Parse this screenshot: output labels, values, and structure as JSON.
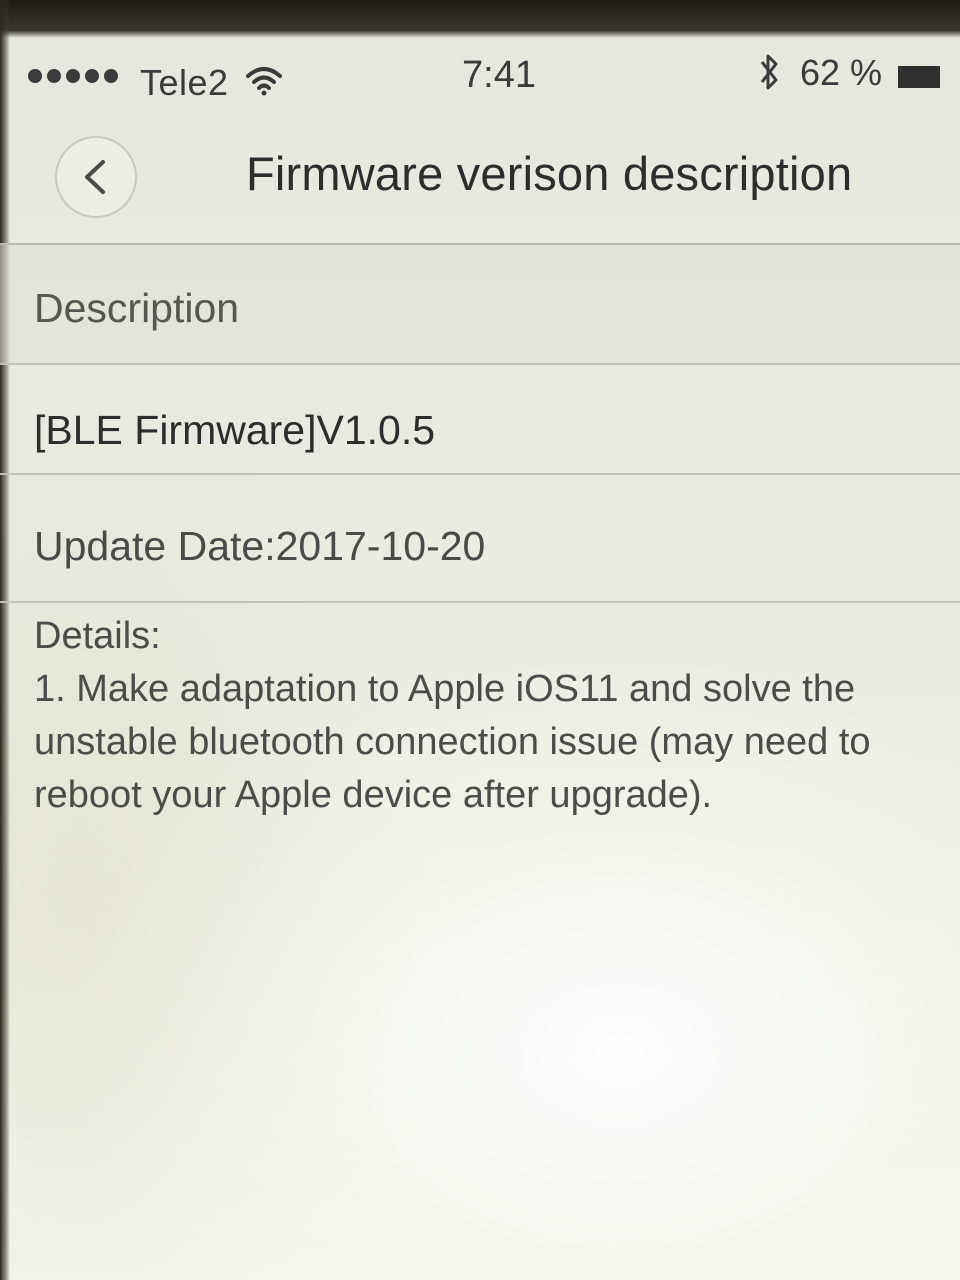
{
  "status_bar": {
    "carrier": "Tele2",
    "time": "7:41",
    "battery_percent": "62 %",
    "signal_bars": 5,
    "battery_level": 0.62
  },
  "nav": {
    "title": "Firmware verison description"
  },
  "content": {
    "section_header": "Description",
    "firmware_version": "[BLE Firmware]V1.0.5",
    "update_date": "Update Date:2017-10-20",
    "details_heading": "Details:",
    "details_body": "1. Make adaptation to Apple iOS11 and solve the unstable bluetooth connection issue (may need to reboot your Apple device after upgrade)."
  },
  "icons": {
    "back": "chevron-left-icon",
    "wifi": "wifi-icon",
    "bluetooth": "bluetooth-icon",
    "battery": "battery-icon"
  }
}
